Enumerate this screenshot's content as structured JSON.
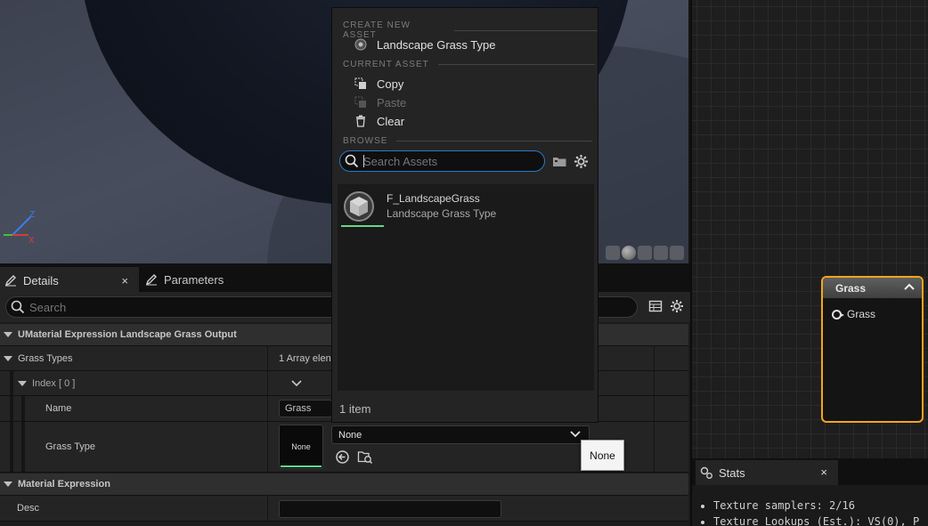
{
  "viewport": {
    "axis_z": "Z",
    "axis_x": "X",
    "axis_y": "Y"
  },
  "details": {
    "tabs": [
      {
        "label": "Details",
        "icon": "pencil-icon"
      },
      {
        "label": "Parameters",
        "icon": "pencil-icon"
      }
    ],
    "close_label": "×",
    "search_placeholder": "Search",
    "categories": {
      "main": "UMaterial Expression Landscape Grass Output",
      "material_expression": "Material Expression"
    },
    "rows": {
      "grass_types_label": "Grass Types",
      "grass_types_value": "1 Array elen",
      "index_label": "Index [ 0 ]",
      "name_label": "Name",
      "name_value": "Grass",
      "grass_type_label": "Grass Type",
      "thumb_label": "None",
      "combo_value": "None",
      "desc_label": "Desc",
      "desc_value": ""
    },
    "tooltip": "None"
  },
  "picker": {
    "section_create": "CREATE NEW ASSET",
    "create_item": "Landscape Grass Type",
    "section_current": "CURRENT ASSET",
    "copy": "Copy",
    "paste": "Paste",
    "clear": "Clear",
    "section_browse": "BROWSE",
    "search_placeholder": "Search Assets",
    "assets": [
      {
        "name": "F_LandscapeGrass",
        "type": "Landscape Grass Type"
      }
    ],
    "count": "1 item"
  },
  "graph": {
    "node_title": "Grass",
    "node_pin": "Grass"
  },
  "stats": {
    "tab_label": "Stats",
    "close_label": "×",
    "lines": [
      "Texture samplers: 2/16",
      "Texture Lookups (Est.): VS(0), P"
    ]
  },
  "colors": {
    "accent_blue": "#2b77c9",
    "node_border": "#f4a51c",
    "asset_green": "#66d58b"
  }
}
